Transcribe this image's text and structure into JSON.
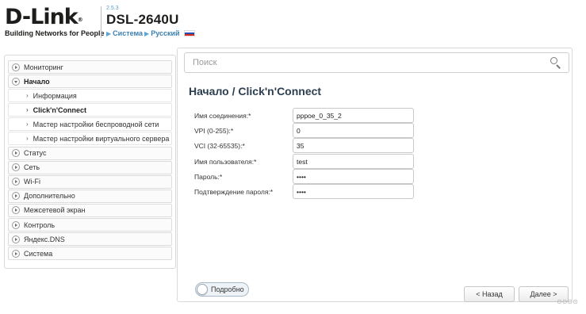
{
  "header": {
    "logo_text": "D-Link",
    "logo_reg": "®",
    "logo_tagline": "Building Networks for People",
    "firmware": "2.5.3",
    "model": "DSL-2640U",
    "crumb_system": "Система",
    "crumb_language": "Русский",
    "flag_colors": [
      "#ffffff",
      "#1c4fb8",
      "#d52b1e"
    ]
  },
  "sidebar": {
    "items": [
      {
        "label": "Мониторинг"
      },
      {
        "label": "Начало"
      },
      {
        "label": "Информация"
      },
      {
        "label": "Click'n'Connect"
      },
      {
        "label": "Мастер настройки беспроводной сети"
      },
      {
        "label": "Мастер настройки виртуального сервера"
      },
      {
        "label": "Статус"
      },
      {
        "label": "Сеть"
      },
      {
        "label": "Wi-Fi"
      },
      {
        "label": "Дополнительно"
      },
      {
        "label": "Межсетевой экран"
      },
      {
        "label": "Контроль"
      },
      {
        "label": "Яндекс.DNS"
      },
      {
        "label": "Система"
      }
    ]
  },
  "search": {
    "placeholder": "Поиск"
  },
  "page": {
    "title": "Начало /  Click'n'Connect"
  },
  "form": {
    "fields": [
      {
        "label": "Имя соединения:*",
        "value": "pppoe_0_35_2"
      },
      {
        "label": "VPI (0-255):*",
        "value": "0"
      },
      {
        "label": "VCI (32-65535):*",
        "value": "35"
      },
      {
        "label": "Имя пользователя:*",
        "value": "test"
      },
      {
        "label": "Пароль:*",
        "value": "••••"
      },
      {
        "label": "Подтверждение пароля:*",
        "value": "••••"
      }
    ]
  },
  "toggle": {
    "label": "Подробно"
  },
  "buttons": {
    "back": "< Назад",
    "next": "Далее >"
  },
  "watermark": "⊙⊙⊙⊙"
}
